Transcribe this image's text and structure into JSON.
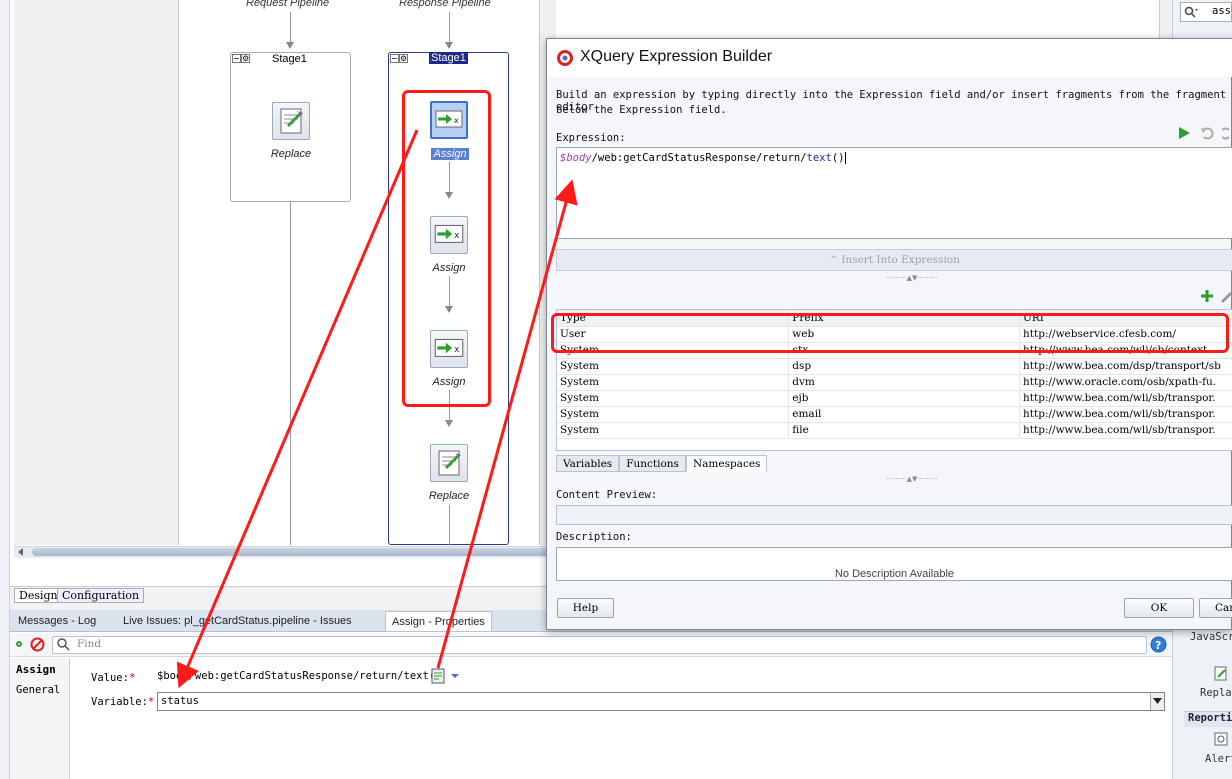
{
  "pipeline": {
    "request_title": "Request Pipeline",
    "response_title": "Response Pipeline",
    "request_stage": "Stage1",
    "response_stage": "Stage1",
    "request_actions": [
      "Replace"
    ],
    "response_actions": [
      "Assign",
      "Assign",
      "Assign",
      "Replace"
    ]
  },
  "editor_tabs": [
    "Design",
    "Configuration"
  ],
  "bottom_tabs": [
    "Messages - Log",
    "Live Issues: pl_getCardStatus.pipeline - Issues",
    "Assign - Properties"
  ],
  "properties": {
    "find_placeholder": "Find",
    "side_items": [
      "Assign",
      "General"
    ],
    "value_label": "Value:",
    "value_text": "$body/web:getCardStatusResponse/return/text()",
    "variable_label": "Variable:",
    "variable_value": "status",
    "required_mark": "*"
  },
  "right_panel": {
    "search_value": "ass",
    "items": [
      "JavaScr",
      "Replac",
      "Reporti",
      "Alert"
    ]
  },
  "dialog": {
    "title": "XQuery Expression Builder",
    "instruction_line1": "Build an expression by typing directly into the Expression field and/or insert fragments from the fragment editor",
    "instruction_line2": "below the Expression field.",
    "expression_label": "Expression:",
    "expression_var": "$body",
    "expression_path": "/web:getCardStatusResponse/return/",
    "expression_fn": "text",
    "expression_parens": "()",
    "insert_button": "Insert Into Expression",
    "table_headers": [
      "Type",
      "Prefix",
      "URI"
    ],
    "table_rows": [
      [
        "User",
        "web",
        "http://webservice.cfesb.com/"
      ],
      [
        "System",
        "ctx",
        "http://www.bea.com/wli/sb/context"
      ],
      [
        "System",
        "dsp",
        "http://www.bea.com/dsp/transport/sb"
      ],
      [
        "System",
        "dvm",
        "http://www.oracle.com/osb/xpath-fu."
      ],
      [
        "System",
        "ejb",
        "http://www.bea.com/wli/sb/transpor."
      ],
      [
        "System",
        "email",
        "http://www.bea.com/wli/sb/transpor."
      ],
      [
        "System",
        "file",
        "http://www.bea.com/wli/sb/transpor."
      ]
    ],
    "sub_tabs": [
      "Variables",
      "Functions",
      "Namespaces"
    ],
    "content_preview_label": "Content Preview:",
    "description_label": "Description:",
    "description_text": "No Description Available",
    "help_button": "Help",
    "ok_button": "OK",
    "cancel_button": "Can"
  },
  "colors": {
    "annotation": "#ff1a1a",
    "selection": "#1c2a8c",
    "accent_green": "#2e9e2e"
  }
}
